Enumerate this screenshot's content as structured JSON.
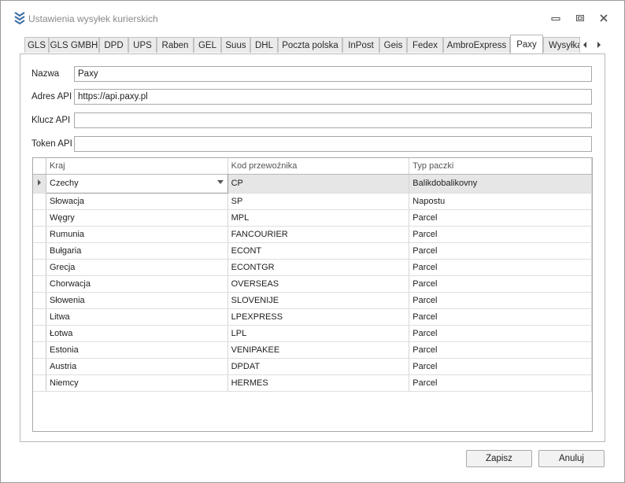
{
  "window": {
    "title": "Ustawienia wysyłek kurierskich",
    "icons": {
      "app": "chevrons-down-icon",
      "minimize": "minimize-icon",
      "restore": "restore-icon",
      "close": "close-icon"
    }
  },
  "tabs": [
    {
      "label": "GLS"
    },
    {
      "label": "GLS GMBH"
    },
    {
      "label": "DPD"
    },
    {
      "label": "UPS"
    },
    {
      "label": "Raben"
    },
    {
      "label": "GEL"
    },
    {
      "label": "Suus"
    },
    {
      "label": "DHL"
    },
    {
      "label": "Poczta polska"
    },
    {
      "label": "InPost"
    },
    {
      "label": "Geis"
    },
    {
      "label": "Fedex"
    },
    {
      "label": "AmbroExpress"
    },
    {
      "label": "Paxy",
      "active": true
    },
    {
      "label": "Wysyłka"
    }
  ],
  "form": {
    "name_label": "Nazwa",
    "name_value": "Paxy",
    "api_address_label": "Adres API",
    "api_address_value": "https://api.paxy.pl",
    "api_key_label": "Klucz API",
    "api_key_value": "",
    "api_token_label": "Token API",
    "api_token_value": ""
  },
  "grid": {
    "columns": [
      "Kraj",
      "Kod przewoźnika",
      "Typ paczki"
    ],
    "rows": [
      [
        "Czechy",
        "CP",
        "Balikdobalikovny"
      ],
      [
        "Słowacja",
        "SP",
        "Napostu"
      ],
      [
        "Węgry",
        "MPL",
        "Parcel"
      ],
      [
        "Rumunia",
        "FANCOURIER",
        "Parcel"
      ],
      [
        "Bułgaria",
        "ECONT",
        "Parcel"
      ],
      [
        "Grecja",
        "ECONTGR",
        "Parcel"
      ],
      [
        "Chorwacja",
        "OVERSEAS",
        "Parcel"
      ],
      [
        "Słowenia",
        "SLOVENIJE",
        "Parcel"
      ],
      [
        "Litwa",
        "LPEXPRESS",
        "Parcel"
      ],
      [
        "Łotwa",
        "LPL",
        "Parcel"
      ],
      [
        "Estonia",
        "VENIPAKEE",
        "Parcel"
      ],
      [
        "Austria",
        "DPDAT",
        "Parcel"
      ],
      [
        "Niemcy",
        "HERMES",
        "Parcel"
      ]
    ],
    "selected_row": 0
  },
  "buttons": {
    "save": "Zapisz",
    "cancel": "Anuluj"
  },
  "colors": {
    "app_icon": "#3b6ea5",
    "selected_row": "#e6e6e6"
  }
}
